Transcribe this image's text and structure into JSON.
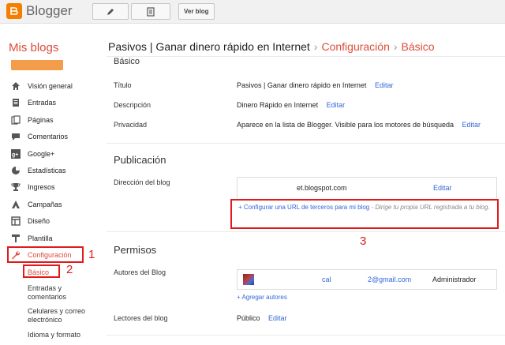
{
  "topbar": {
    "brand": "Blogger",
    "view_blog_label": "Ver blog",
    "icons": [
      "blogger-logo-icon",
      "pencil-icon",
      "posts-list-icon"
    ]
  },
  "header": {
    "my_blogs": "Mis blogs",
    "blog_name": "Pasivos | Ganar dinero rápido en Internet",
    "crumb_settings": "Configuración",
    "crumb_basic": "Básico",
    "separator": "›"
  },
  "sidebar": {
    "items": [
      {
        "label": "Visión general",
        "icon": "home-icon"
      },
      {
        "label": "Entradas",
        "icon": "posts-icon"
      },
      {
        "label": "Páginas",
        "icon": "pages-icon"
      },
      {
        "label": "Comentarios",
        "icon": "comments-icon"
      },
      {
        "label": "Google+",
        "icon": "google-plus-icon"
      },
      {
        "label": "Estadísticas",
        "icon": "stats-icon"
      },
      {
        "label": "Ingresos",
        "icon": "trophy-icon"
      },
      {
        "label": "Campañas",
        "icon": "campaigns-icon"
      },
      {
        "label": "Diseño",
        "icon": "layout-icon"
      },
      {
        "label": "Plantilla",
        "icon": "template-icon"
      },
      {
        "label": "Configuración",
        "icon": "wrench-icon"
      }
    ],
    "subitems": [
      {
        "label": "Básico"
      },
      {
        "label": "Entradas y\ncomentarios"
      },
      {
        "label": "Celulares y correo\nelectrónico"
      },
      {
        "label": "Idioma y formato"
      }
    ]
  },
  "basic": {
    "section_title": "Básico",
    "rows": [
      {
        "label": "Título",
        "value": "Pasivos | Ganar dinero rápido en Internet",
        "action": "Editar"
      },
      {
        "label": "Descripción",
        "value": "Dinero Rápido en Internet",
        "action": "Editar"
      },
      {
        "label": "Privacidad",
        "value": "Aparece en la lista de Blogger. Visible para los motores de búsqueda",
        "action": "Editar"
      }
    ]
  },
  "publication": {
    "section_title": "Publicación",
    "address_label": "Dirección del blog",
    "address_value": "et.blogspot.com",
    "address_action": "Editar",
    "custom_domain_link": "+ Configurar una URL de terceros para mi blog",
    "custom_domain_hint": " - Dirige tu propia URL registrada a tu blog."
  },
  "permissions": {
    "section_title": "Permisos",
    "authors_label": "Autores del Blog",
    "author_name": "cal",
    "author_email": "2@gmail.com",
    "author_role": "Administrador",
    "add_authors": "+ Agregar autores",
    "readers_label": "Lectores del blog",
    "readers_value": "Público",
    "readers_action": "Editar"
  },
  "annotations": {
    "labels": [
      "1",
      "2",
      "3"
    ],
    "color": "#e31a1c"
  },
  "colors": {
    "accent": "#dd4b39",
    "link": "#3367d6",
    "brand_orange": "#f57d00"
  }
}
